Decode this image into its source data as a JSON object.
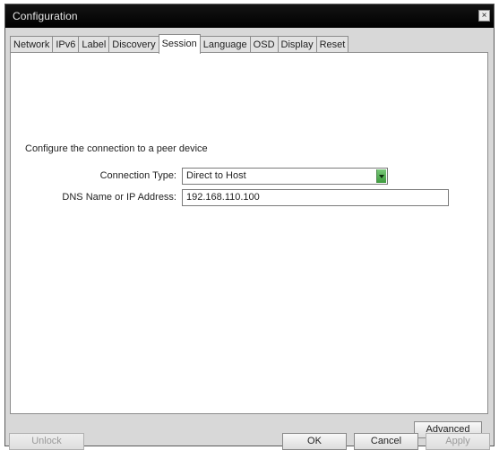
{
  "window": {
    "title": "Configuration",
    "close_label": "×"
  },
  "tabs": [
    {
      "label": "Network"
    },
    {
      "label": "IPv6"
    },
    {
      "label": "Label"
    },
    {
      "label": "Discovery"
    },
    {
      "label": "Session",
      "active": true
    },
    {
      "label": "Language"
    },
    {
      "label": "OSD"
    },
    {
      "label": "Display"
    },
    {
      "label": "Reset"
    }
  ],
  "session": {
    "heading": "Configure the connection to a peer device",
    "connection_type_label": "Connection Type:",
    "connection_type_value": "Direct to Host",
    "dns_label": "DNS Name or IP Address:",
    "dns_value": "192.168.110.100",
    "advanced_label": "Advanced"
  },
  "footer": {
    "unlock_label": "Unlock",
    "ok_label": "OK",
    "cancel_label": "Cancel",
    "apply_label": "Apply"
  },
  "colors": {
    "titlebar": "#000000",
    "dropdown_arrow": "#4caf50",
    "body": "#d8d8d8"
  }
}
